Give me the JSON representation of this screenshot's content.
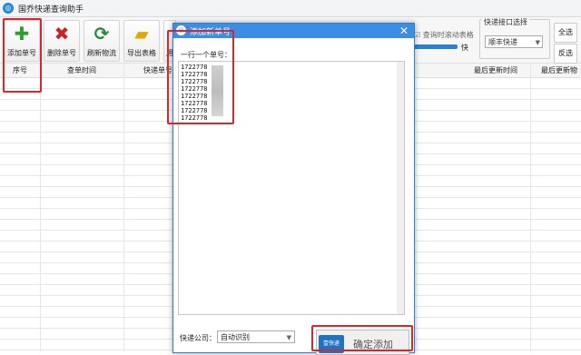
{
  "app": {
    "title": "国乔快递查询助手"
  },
  "toolbar": {
    "add_label": "添加单号",
    "delete_label": "删除单号",
    "refresh_label": "刷新物流",
    "export_label": "导出表格",
    "partial_label": "用",
    "scroll_option": "查询时滚动表格",
    "speed_label": "快"
  },
  "api": {
    "group_title": "快递接口选择",
    "selected": "顺丰快递",
    "select_all": "全选",
    "invert": "反选"
  },
  "table": {
    "columns": [
      "序号",
      "查单时间",
      "快递单号",
      "最后更新时间",
      "最后更新物"
    ]
  },
  "dialog": {
    "title": "添加新单号",
    "prompt": "一行一个单号：",
    "tracking_numbers": [
      "1722778",
      "1722778",
      "1722778",
      "1722778",
      "1722778",
      "1722778",
      "1722778",
      "1722778"
    ],
    "courier_label": "快递公司：",
    "courier_value": "自动识别",
    "confirm_label": "确定添加",
    "confirm_logo": "壹快递"
  }
}
